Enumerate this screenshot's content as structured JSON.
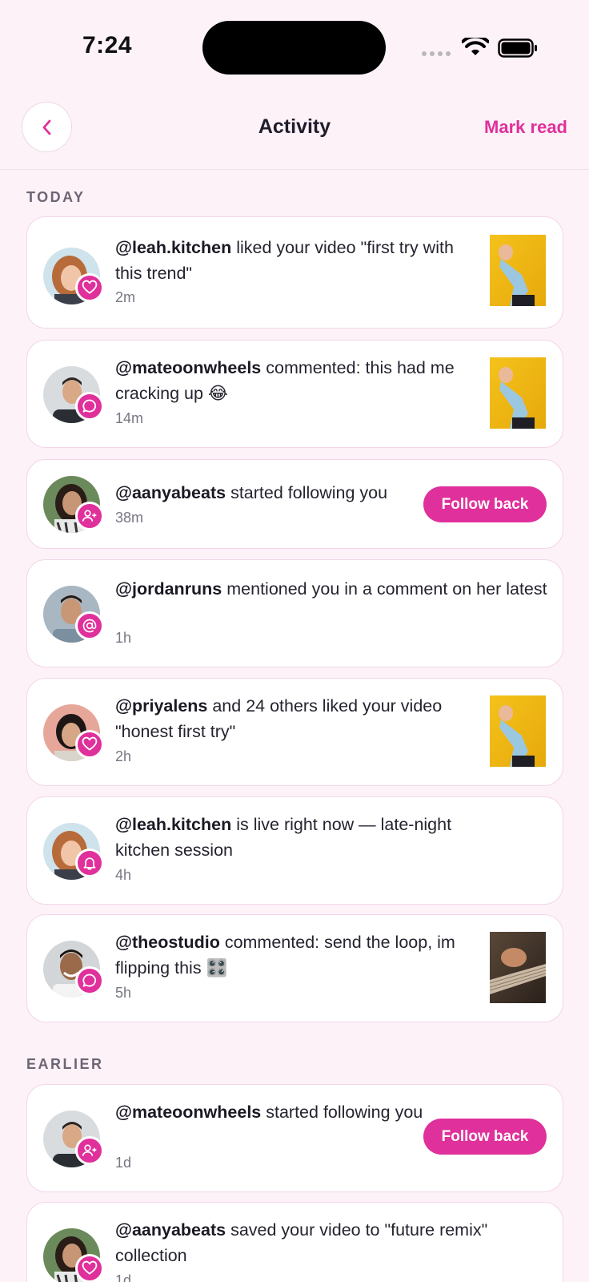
{
  "status": {
    "time": "7:24"
  },
  "header": {
    "title": "Activity",
    "mark_read": "Mark read"
  },
  "sections": {
    "today": "TODAY",
    "earlier": "EARLIER"
  },
  "colors": {
    "accent": "#e0309b",
    "background": "#fdf2f8",
    "card_border": "#f2d6e8"
  },
  "items": [
    {
      "user": "@leah.kitchen",
      "text": " liked your video \"first try with this trend\"",
      "time": "2m",
      "badge": "heart-icon",
      "thumb": "yellow-dancer"
    },
    {
      "user": "@mateoonwheels",
      "text": " commented: this had me cracking up 😂",
      "time": "14m",
      "badge": "comment-icon",
      "thumb": "yellow-dancer"
    },
    {
      "user": "@aanyabeats",
      "text": " started following you",
      "time": "38m",
      "badge": "user-plus-icon",
      "button": "Follow back"
    },
    {
      "user": "@jordanruns",
      "text": " mentioned you in a comment on her latest",
      "time": "1h",
      "badge": "at-icon"
    },
    {
      "user": "@priyalens",
      "text": " and 24 others liked your video \"honest first try\"",
      "time": "2h",
      "badge": "heart-icon",
      "thumb": "yellow-dancer"
    },
    {
      "user": "@leah.kitchen",
      "text": " is live right now — late-night kitchen session",
      "time": "4h",
      "badge": "bell-icon"
    },
    {
      "user": "@theostudio",
      "text": " commented: send the loop, im flipping this 🎛️",
      "time": "5h",
      "badge": "comment-icon",
      "thumb": "guitar"
    },
    {
      "user": "@mateoonwheels",
      "text": " started following you",
      "time": "1d",
      "badge": "user-plus-icon",
      "button": "Follow back"
    },
    {
      "user": "@aanyabeats",
      "text": " saved your video to \"future remix\" collection",
      "time": "1d",
      "badge": "heart-icon"
    }
  ]
}
